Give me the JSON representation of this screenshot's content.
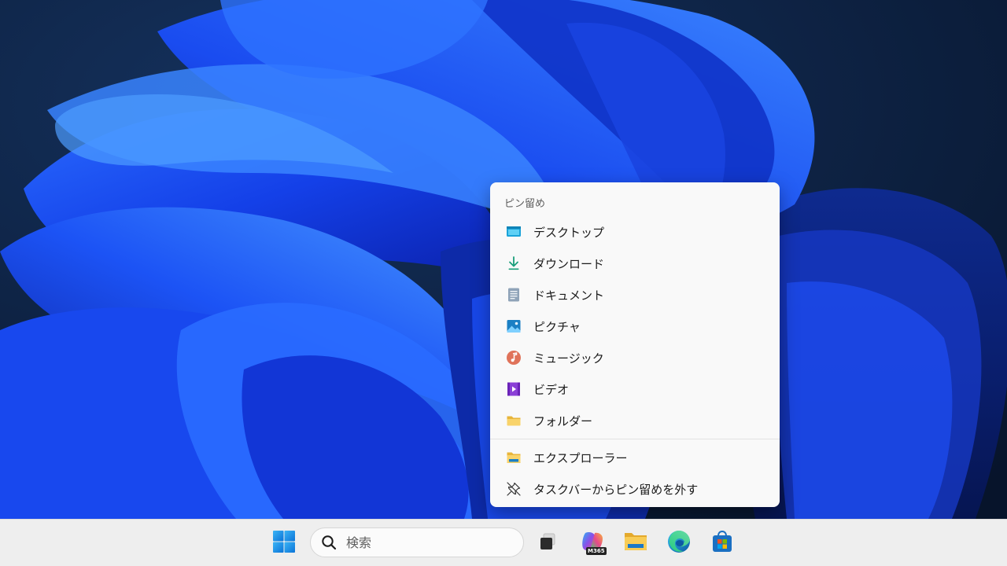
{
  "jumplist": {
    "section_title": "ピン留め",
    "pinned": [
      {
        "label": "デスクトップ",
        "icon": "desktop-folder-icon"
      },
      {
        "label": "ダウンロード",
        "icon": "download-arrow-icon"
      },
      {
        "label": "ドキュメント",
        "icon": "document-icon"
      },
      {
        "label": "ピクチャ",
        "icon": "pictures-icon"
      },
      {
        "label": "ミュージック",
        "icon": "music-icon"
      },
      {
        "label": "ビデオ",
        "icon": "video-icon"
      },
      {
        "label": "フォルダー",
        "icon": "folder-icon"
      }
    ],
    "actions": [
      {
        "label": "エクスプローラー",
        "icon": "file-explorer-icon"
      },
      {
        "label": "タスクバーからピン留めを外す",
        "icon": "unpin-icon"
      }
    ]
  },
  "taskbar": {
    "search_placeholder": "検索",
    "apps": [
      {
        "name": "start-button",
        "icon": "windows-logo-icon"
      },
      {
        "name": "task-view-button",
        "icon": "task-view-icon"
      },
      {
        "name": "microsoft-365-button",
        "icon": "microsoft-365-icon",
        "badge": "M365"
      },
      {
        "name": "file-explorer-button",
        "icon": "file-explorer-icon"
      },
      {
        "name": "edge-button",
        "icon": "edge-icon"
      },
      {
        "name": "store-button",
        "icon": "microsoft-store-icon"
      }
    ]
  },
  "colors": {
    "wallpaper_dark": "#0a1a33",
    "wallpaper_blue": "#1a4dff",
    "menu_background": "#f9f9f9",
    "taskbar_background": "#eeeeee"
  }
}
